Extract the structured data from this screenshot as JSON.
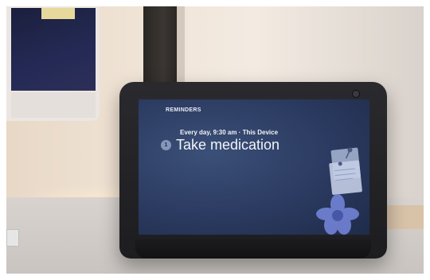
{
  "device": {
    "section_label": "REMINDERS",
    "reminder": {
      "index": "1",
      "schedule": "Every day, 9:30 am · This Device",
      "title": "Take medication"
    }
  },
  "icons": [
    "camera-icon",
    "pinned-notes-icon",
    "flower-icon"
  ],
  "colors": {
    "screen_bg": "#2b3a60",
    "badge": "#8596b8",
    "text": "#f2f4f9",
    "device_body": "#1d1d20"
  }
}
